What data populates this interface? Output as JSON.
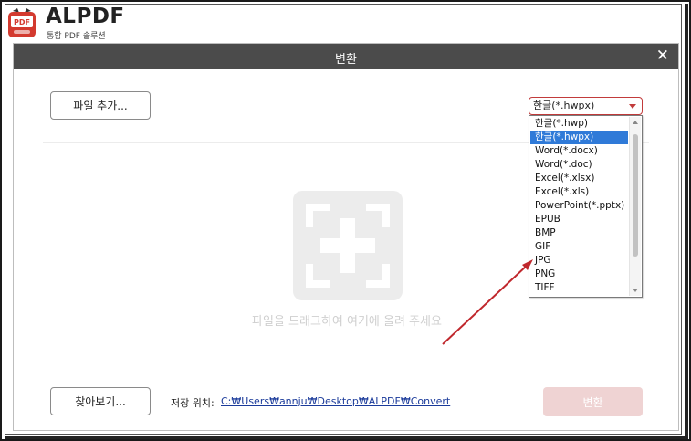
{
  "app": {
    "logo_text": "PDF",
    "title": "ALPDF",
    "subtitle": "통합 PDF 솔루션"
  },
  "dialog": {
    "title": "변환",
    "close_icon": "close-icon",
    "add_file_label": "파일 추가...",
    "select_value": "한글(*.hwpx)",
    "formats": [
      {
        "label": "한글(*.hwp)",
        "selected": false
      },
      {
        "label": "한글(*.hwpx)",
        "selected": true
      },
      {
        "label": "Word(*.docx)",
        "selected": false
      },
      {
        "label": "Word(*.doc)",
        "selected": false
      },
      {
        "label": "Excel(*.xlsx)",
        "selected": false
      },
      {
        "label": "Excel(*.xls)",
        "selected": false
      },
      {
        "label": "PowerPoint(*.pptx)",
        "selected": false
      },
      {
        "label": "EPUB",
        "selected": false
      },
      {
        "label": "BMP",
        "selected": false
      },
      {
        "label": "GIF",
        "selected": false
      },
      {
        "label": "JPG",
        "selected": false
      },
      {
        "label": "PNG",
        "selected": false
      },
      {
        "label": "TIFF",
        "selected": false
      }
    ],
    "drop_hint": "파일을 드래그하여 여기에 올려 주세요",
    "browse_label": "찾아보기...",
    "save_location_label": "저장 위치:",
    "save_path": "C:₩Users₩annju₩Desktop₩ALPDF₩Convert",
    "convert_label": "변환"
  },
  "colors": {
    "titlebar": "#4b4b4b",
    "accent": "#c23b3b",
    "selection": "#2f7ad8",
    "convert_disabled": "#efd3d3",
    "annotation_arrow": "#c0282d"
  }
}
